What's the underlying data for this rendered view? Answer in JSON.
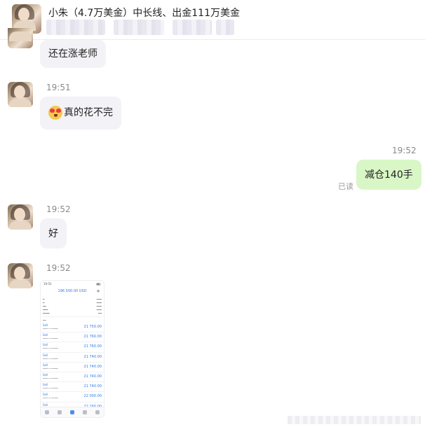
{
  "header": {
    "title": "小朱（4.7万美金）中长线、出金111万美金"
  },
  "messages": [
    {
      "side": "left",
      "text": "还在涨老师"
    },
    {
      "side": "left",
      "time": "19:51",
      "text": "真的花不完",
      "emoji": "heart-eyes-emoji"
    },
    {
      "side": "right",
      "time": "19:52",
      "text": "减仓140手",
      "status": "已读"
    },
    {
      "side": "left",
      "time": "19:52",
      "text": "好"
    },
    {
      "side": "left",
      "time": "19:52",
      "type": "image"
    }
  ],
  "screenshot": {
    "time": "19:52",
    "balance": "196 500.00 USD",
    "rows": [
      {
        "label": "Sell",
        "amount": "21 750.00"
      },
      {
        "label": "Sell",
        "amount": "21 760.00"
      },
      {
        "label": "Sell",
        "amount": "21 760.00"
      },
      {
        "label": "Sell",
        "amount": "21 740.00"
      },
      {
        "label": "Sell",
        "amount": "21 740.00"
      },
      {
        "label": "Sell",
        "amount": "21 740.00"
      },
      {
        "label": "Sell",
        "amount": "21 740.00"
      },
      {
        "label": "Sell",
        "amount": "22 000.00"
      },
      {
        "label": "Sell",
        "amount": "22 160.00"
      }
    ]
  },
  "colors": {
    "right_bubble": "#d9f7c6",
    "left_bubble": "#f2f2f7",
    "link_blue": "#2e7be8"
  }
}
